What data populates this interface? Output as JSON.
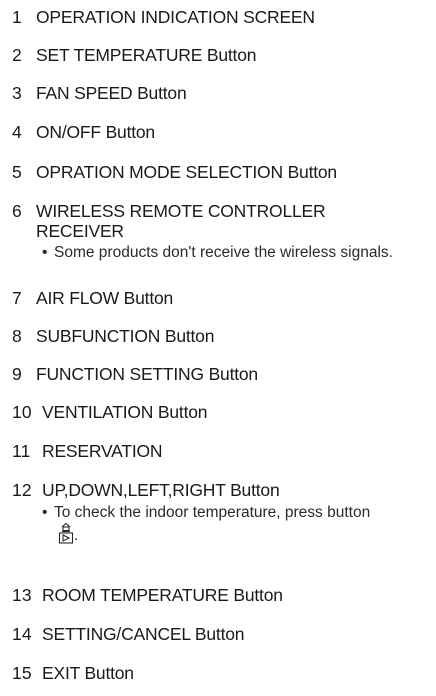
{
  "items": [
    {
      "num": "1",
      "label": "OPERATION INDICATION SCREEN"
    },
    {
      "num": "2",
      "label": "SET TEMPERATURE Button"
    },
    {
      "num": "3",
      "label": "FAN SPEED Button"
    },
    {
      "num": "4",
      "label": "ON/OFF Button"
    },
    {
      "num": "5",
      "label": "OPRATION MODE SELECTION Button"
    },
    {
      "num": "6",
      "label": "WIRELESS REMOTE CONTROLLER",
      "label2": "RECEIVER",
      "note": "Some products don't receive the wireless signals."
    },
    {
      "num": "7",
      "label": "AIR FLOW Button"
    },
    {
      "num": "8",
      "label": "SUBFUNCTION Button"
    },
    {
      "num": "9",
      "label": "FUNCTION SETTING Button"
    },
    {
      "num": "10",
      "label": "VENTILATION Button"
    },
    {
      "num": "11",
      "label": "RESERVATION"
    },
    {
      "num": "12",
      "label": "UP,DOWN,LEFT,RIGHT Button",
      "note": "To check the indoor temperature, press button",
      "note_end": "."
    },
    {
      "num": "13",
      "label": "ROOM TEMPERATURE Button"
    },
    {
      "num": "14",
      "label": "SETTING/CANCEL Button"
    },
    {
      "num": "15",
      "label": "EXIT Button"
    }
  ],
  "bullet": "•",
  "icons": {
    "room_temp": "room-temperature-button-icon"
  }
}
